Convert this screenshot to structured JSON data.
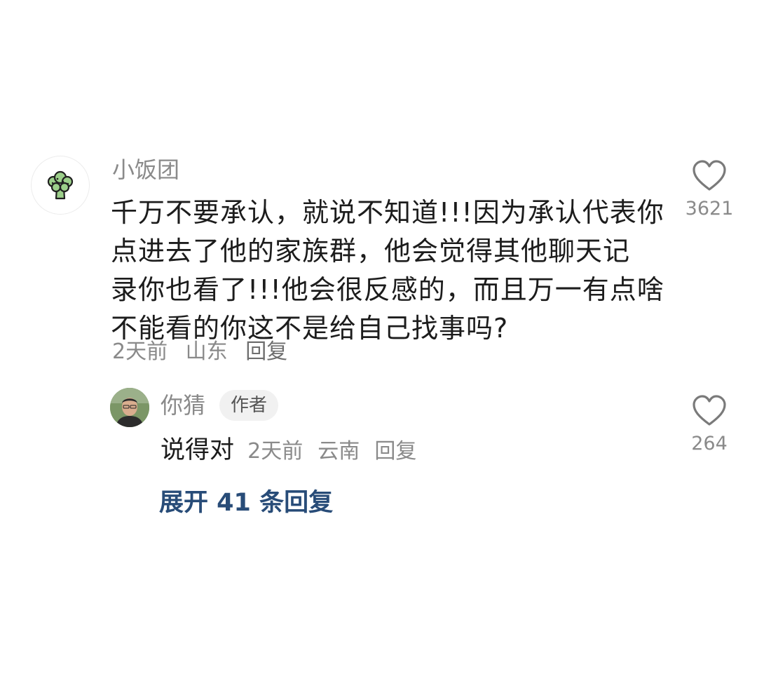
{
  "comment": {
    "username": "小饭团",
    "avatar_icon": "broccoli-icon",
    "content_lines": [
      "千万不要承认，就说不知道!!!因为承认代表你",
      "点进去了他的家族群，他会觉得其他聊天记",
      "录你也看了!!!他会很反感的，而且万一有点啥",
      "不能看的你这不是给自己找事吗?"
    ],
    "time": "2天前",
    "location": "山东",
    "reply_label": "回复",
    "like_count": "3621"
  },
  "reply": {
    "username": "你猜",
    "badge": "作者",
    "text": "说得对",
    "time": "2天前",
    "location": "云南",
    "reply_label": "回复",
    "like_count": "264"
  },
  "expand_label": "展开 41 条回复",
  "colors": {
    "primary_text": "#1c1c1c",
    "secondary_text": "#8a8a8a",
    "link": "#284c78",
    "badge_bg": "#f1f1f1"
  }
}
